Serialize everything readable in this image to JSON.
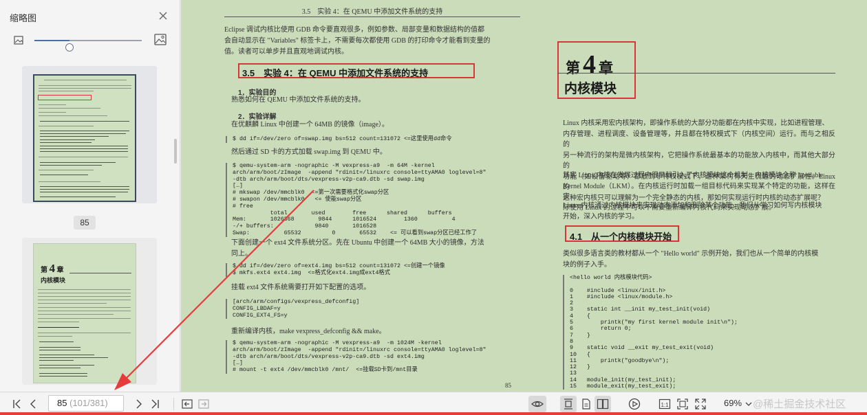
{
  "sidebar": {
    "title": "缩略图",
    "zoom_fraction": 0.33,
    "thumbnails": [
      {
        "page_label": "85",
        "selected": true
      },
      {
        "page_label": "",
        "selected": false,
        "chapter_no": "4",
        "chapter_word": "第",
        "chapter_suffix": "章",
        "chapter_title": "内核模块"
      }
    ]
  },
  "left_page": {
    "running_head": "3.5　实验 4：在 QEMU 中添加文件系统的支持",
    "intro": "Eclipse 调试内核比使用 GDB 命令要直观很多，例如参数、局部变量和数据结构的值都\n会自动显示在 \"Variables\" 标签卡上，不需要每次都使用 GDB 的打印命令才能看到变量的\n值。读者可以单步并且直观地调试内核。",
    "section": "3.5　实验 4：在 QEMU 中添加文件系统的支持",
    "h1": "1．实验目的",
    "p1": "熟悉如何在 QEMU 中添加文件系统的支持。",
    "h2": "2．实验详解",
    "p2": "在优麒麟 Linux 中创建一个 64MB 的镜像（image）。",
    "code1": "$ dd if=/dev/zero of=swap.img bs=512 count=131072 <=这里使用dd命令",
    "p3": "然后通过 SD 卡的方式加载 swap.img 到 QEMU 中。",
    "code2": "$ qemu-system-arm -nographic -M vexpress-a9  -m 64M -kernel\narch/arm/boot/zImage  -append \"rdinit=/linuxrc console=ttyAMA0 loglevel=8\"\n-dtb arch/arm/boot/dts/vexpress-v2p-ca9.dtb -sd swap.img\n[…]\n# mkswap /dev/mmcblk0  <=第一次需要格式化swap分区\n# swapon /dev/mmcblk0   <= 使能swap分区\n# free\n           total       used        free      shared      buffers\nMem:       1026368       9844      1016524        1360          4\n-/+ buffers:            9840       1016528\nSwap:          65532         0       65532    <= 可以看到swap分区已经工作了",
    "p4": "下面创建一个 ext4 文件系统分区。先在 Ubuntu 中创建一个 64MB 大小的镜像，方法\n同上。",
    "code3": "$ dd if=/dev/zero of=ext4.img bs=512 count=131072 <=创建一个镜像\n$ mkfs.ext4 ext4.img  <=格式化ext4.img成ext4格式",
    "p5": "挂载 ext4 文件系统需要打开如下配置的选项。",
    "code4": "[arch/arm/configs/vexpress_defconfig]\nCONFIG_LBDAF=y\nCONFIG_EXT4_FS=y",
    "p6": "重新编译内核，make vexpress_defconfig && make。",
    "code5": "$ qemu-system-arm -nographic -M vexpress-a9  -m 1024M -kernel\narch/arm/boot/zImage  -append \"rdinit=/linuxrc console=ttyAMA0 loglevel=8\"\n-dtb arch/arm/boot/dts/vexpress-v2p-ca9.dtb -sd ext4.img\n[…]\n# mount -t ext4 /dev/mmcblk0 /mnt/  <=挂载SD卡到/mnt目录",
    "page_number": "85"
  },
  "right_page": {
    "chapter_word": "第",
    "chapter_no": "4",
    "chapter_suffix": "章",
    "chapter_title": "内核模块",
    "p1": "Linux 内核采用宏内核架构，即操作系统的大部分功能都在内核中实现，比如进程管理、\n内存管理、进程调度、设备管理等，并且都在特权模式下（内核空间）运行。而与之相反的\n另一种流行的架构是微内核架构，它把操作系统最基本的功能放入内核中，而其他大部分的\n功能（如设备驱动等）都放到非特权模式下，这种架构有天生优越的动态扩展性。Linux 的\n这种宏内核只可以理解为一个完全静态的内核，那如何实现运行时内核的动态扩展呢？",
    "p2": "其实 Linux 内核在发展过程中很早就引入了内核模块这个机制，内核模块全称 Loadable\nKernel Module（LKM）。在内核运行时加载一组目标代码来实现某个特定的功能，这样在实\n际使用 Linux 的过程中可以不需要重新编译内核代码来实现动态扩展。",
    "p3": "Linux 内核通过内核模块来实现动态添加和删除某个功能。我们从学习如何写内核模块\n开始，深入内核的学习。",
    "section": "4.1　从一个内核模块开始",
    "p4": "类似很多语言类的教材都从一个 \"Hello world\" 示例开始，我们也从一个简单的内核模\n块的例子入手。",
    "code": "<hello world 内核模块代码>\n\n0    #include <linux/init.h>\n1    #include <linux/module.h>\n2\n3    static int __init my_test_init(void)\n4    {\n5        printk(\"my first kernel module init\\n\");\n6        return 0;\n7    }\n8\n9    static void __exit my_test_exit(void)\n10   {\n11       printk(\"goodbye\\n\");\n12   }\n13\n14   module_init(my_test_init);\n15   module_exit(my_test_exit);"
  },
  "toolbar": {
    "page_current": "85",
    "page_detail": "(101/381)",
    "zoom": "69%",
    "watermark": "@稀土掘金技术社区"
  },
  "colors": {
    "page_bg": "#cbdcba",
    "highlight_box": "#d83636",
    "arrow": "#e63c3c"
  },
  "icons": [
    "close-icon",
    "image-small-icon",
    "image-large-icon",
    "first-page-icon",
    "prev-page-icon",
    "next-page-icon",
    "last-page-icon",
    "back-icon",
    "forward-icon",
    "eye-icon",
    "single-page-icon",
    "page-icon",
    "two-page-icon",
    "play-icon",
    "actual-size-icon",
    "fit-page-icon",
    "fullscreen-icon",
    "zoom-dropdown-icon"
  ]
}
